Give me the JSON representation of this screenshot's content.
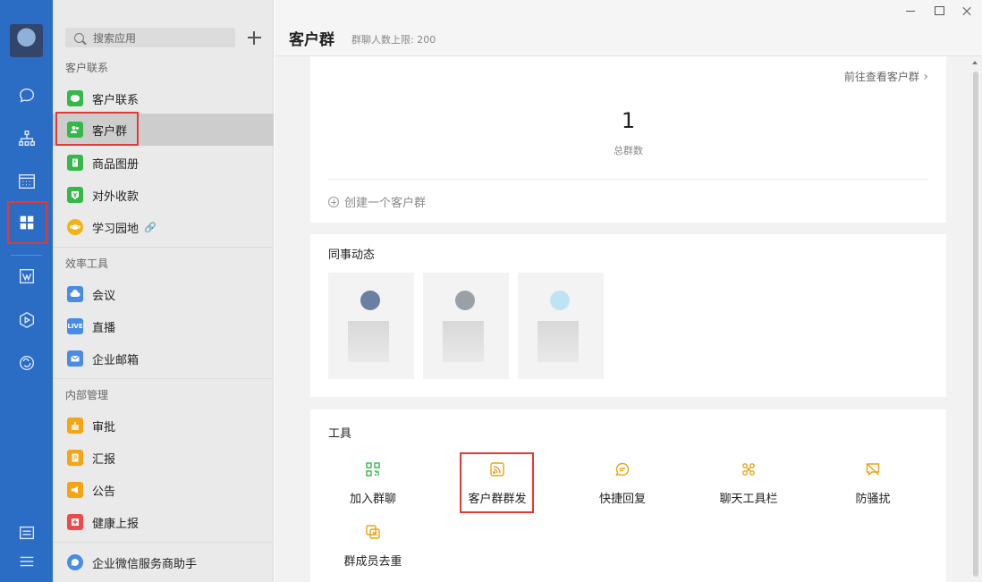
{
  "rail": {
    "icons": [
      "chat-icon",
      "org-icon",
      "calendar-icon",
      "apps-icon",
      "doc-icon",
      "box-icon",
      "cloud-icon",
      "settings-icon",
      "menu-icon"
    ]
  },
  "nav": {
    "search_placeholder": "搜索应用",
    "sections": [
      {
        "title": "客户联系",
        "items": [
          {
            "label": "客户联系",
            "color": "#35b74a"
          },
          {
            "label": "客户群",
            "color": "#35b74a"
          },
          {
            "label": "商品图册",
            "color": "#35b74a"
          },
          {
            "label": "对外收款",
            "color": "#35b74a"
          },
          {
            "label": "学习园地",
            "color": "#f2b312"
          }
        ]
      },
      {
        "title": "效率工具",
        "items": [
          {
            "label": "会议",
            "color": "#4a8be6"
          },
          {
            "label": "直播",
            "color": "#4a8be6",
            "badge": "LIVE"
          },
          {
            "label": "企业邮箱",
            "color": "#4a8be6"
          }
        ]
      },
      {
        "title": "内部管理",
        "items": [
          {
            "label": "审批",
            "color": "#f2a516"
          },
          {
            "label": "汇报",
            "color": "#f2a516"
          },
          {
            "label": "公告",
            "color": "#f2a516"
          },
          {
            "label": "健康上报",
            "color": "#ec4b4b"
          }
        ]
      }
    ],
    "footer_item": {
      "label": "企业微信服务商助手",
      "color": "#4a8be6"
    }
  },
  "header": {
    "title": "客户群",
    "subtitle": "群聊人数上限: 200"
  },
  "summary": {
    "go_link": "前往查看客户群",
    "total_count": "1",
    "total_label": "总群数",
    "create_label": "创建一个客户群"
  },
  "colleagues": {
    "title": "同事动态",
    "avatar_colors": [
      "#6b7fa3",
      "#9aa0a8",
      "#bfe3f3"
    ]
  },
  "tools": {
    "title": "工具",
    "accent": "#e6a517",
    "items": [
      {
        "label": "加入群聊",
        "icon": "qr-icon",
        "color": "#35b74a"
      },
      {
        "label": "客户群群发",
        "icon": "broadcast-icon",
        "color": "#e6a517"
      },
      {
        "label": "快捷回复",
        "icon": "reply-bubble-icon",
        "color": "#e6a517"
      },
      {
        "label": "聊天工具栏",
        "icon": "toolbar-icon",
        "color": "#e6a517"
      },
      {
        "label": "防骚扰",
        "icon": "no-disturb-icon",
        "color": "#e6a517"
      },
      {
        "label": "群成员去重",
        "icon": "dedupe-icon",
        "color": "#e6a517"
      }
    ]
  }
}
